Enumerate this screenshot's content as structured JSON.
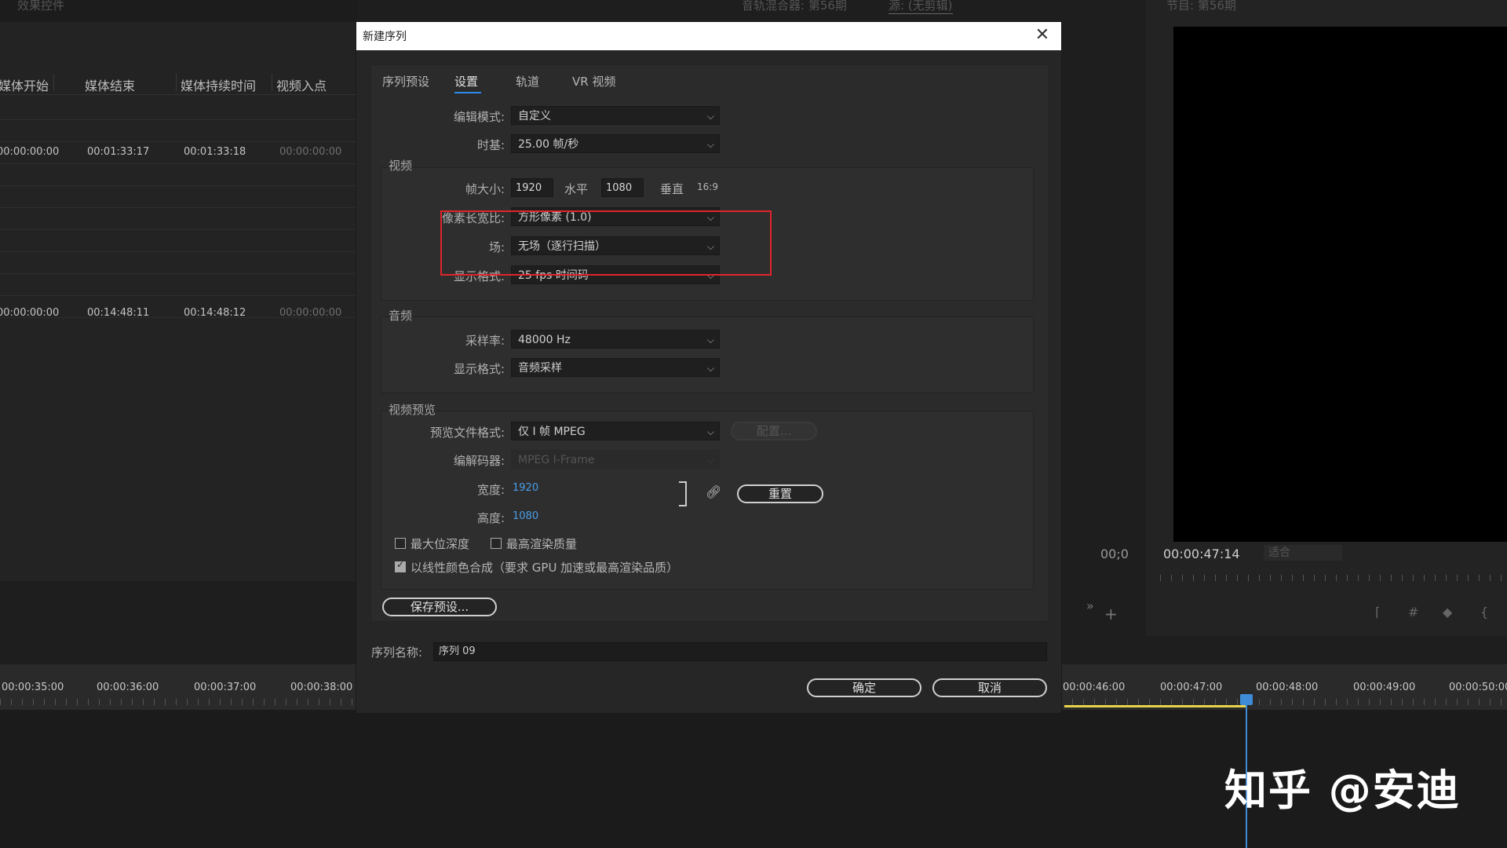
{
  "background": {
    "left_top_label": "效果控件",
    "mid_top_label": "音轨混合器: 第56期",
    "mid_top_label2": "源: (无剪辑)",
    "right_top_label": "节目: 第56期",
    "columns": [
      "媒体开始",
      "媒体结束",
      "媒体持续时间",
      "视频入点"
    ],
    "rows": [
      [
        "00:00:00:00",
        "00:01:33:17",
        "00:01:33:18",
        "00:00:00:00"
      ],
      [
        "00:00:00:00",
        "00:14:48:11",
        "00:14:48:12",
        "00:00:00:00"
      ]
    ],
    "mid_timecode": "00;0",
    "monitor_timecode": "00:00:47:14",
    "monitor_zoom": "适合",
    "timeline_labels_left": [
      "00:00:35:00",
      "00:00:36:00",
      "00:00:37:00",
      "00:00:38:00"
    ],
    "timeline_labels_right": [
      "00:00:46:00",
      "00:00:47:00",
      "00:00:48:00",
      "00:00:49:00",
      "00:00:50:00"
    ],
    "watermark": "知乎 @安迪"
  },
  "dialog": {
    "title": "新建序列",
    "tabs": [
      "序列预设",
      "设置",
      "轨道",
      "VR 视频"
    ],
    "active_tab": "设置",
    "edit_mode_label": "编辑模式:",
    "edit_mode_value": "自定义",
    "timebase_label": "时基:",
    "timebase_value": "25.00 帧/秒",
    "video": {
      "title": "视频",
      "frame_size_label": "帧大小:",
      "frame_width": "1920",
      "horizontal_label": "水平",
      "frame_height": "1080",
      "vertical_label": "垂直",
      "aspect": "16:9",
      "pixel_aspect_label": "像素长宽比:",
      "pixel_aspect_value": "方形像素 (1.0)",
      "field_label": "场:",
      "field_value": "无场（逐行扫描）",
      "display_format_label": "显示格式:",
      "display_format_value": "25 fps 时间码"
    },
    "audio": {
      "title": "音频",
      "sample_rate_label": "采样率:",
      "sample_rate_value": "48000 Hz",
      "display_format_label": "显示格式:",
      "display_format_value": "音频采样"
    },
    "preview": {
      "title": "视频预览",
      "file_format_label": "预览文件格式:",
      "file_format_value": "仅 I 帧 MPEG",
      "configure_label": "配置...",
      "codec_label": "编解码器:",
      "codec_value": "MPEG I-Frame",
      "width_label": "宽度:",
      "width_value": "1920",
      "height_label": "高度:",
      "height_value": "1080",
      "reset_label": "重置"
    },
    "options": {
      "max_bit_depth": "最大位深度",
      "max_render_quality": "最高渲染质量",
      "linear_color": "以线性颜色合成（要求 GPU 加速或最高渲染品质）",
      "max_bit_depth_checked": false,
      "max_render_quality_checked": false,
      "linear_color_checked": true
    },
    "save_preset_label": "保存预设...",
    "sequence_name_label": "序列名称:",
    "sequence_name_value": "序列 09",
    "ok_label": "确定",
    "cancel_label": "取消",
    "highlight_color": "#e0252a",
    "accent_color": "#2d8ceb"
  }
}
